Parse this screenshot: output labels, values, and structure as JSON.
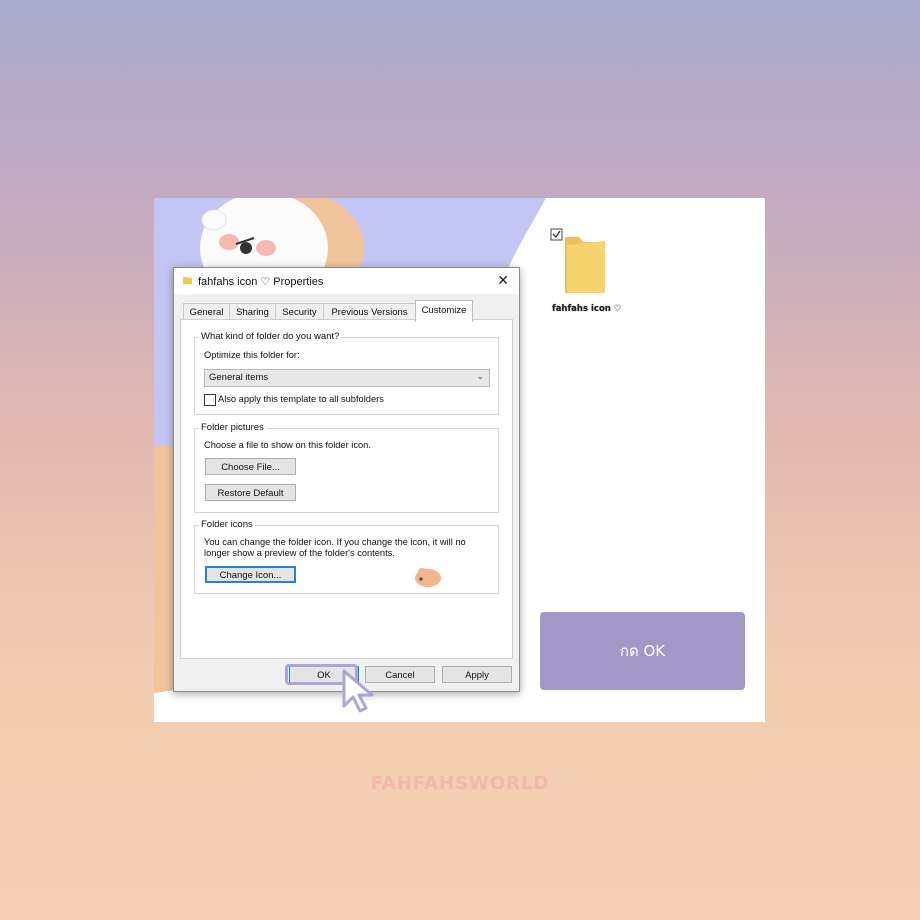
{
  "dialog": {
    "title": "fahfahs icon ♡ Properties",
    "close_glyph": "✕",
    "tabs": [
      {
        "label": "General"
      },
      {
        "label": "Sharing"
      },
      {
        "label": "Security"
      },
      {
        "label": "Previous Versions"
      },
      {
        "label": "Customize",
        "active": true
      }
    ],
    "folder_type": {
      "legend": "What kind of folder do you want?",
      "optimize_label": "Optimize this folder for:",
      "selected": "General items",
      "apply_subfolders_label": "Also apply this template to all subfolders",
      "apply_subfolders_checked": false
    },
    "folder_pictures": {
      "legend": "Folder pictures",
      "description": "Choose a file to show on this folder icon.",
      "choose_file_label": "Choose File...",
      "restore_default_label": "Restore Default"
    },
    "folder_icons": {
      "legend": "Folder icons",
      "description_line1": "You can change the folder icon. If you change the icon, it will no",
      "description_line2": "longer show a preview of the folder's contents.",
      "change_icon_label": "Change Icon..."
    },
    "footer": {
      "ok_label": "OK",
      "cancel_label": "Cancel",
      "apply_label": "Apply"
    }
  },
  "desktop": {
    "folder_label": "fahfahs icon ♡",
    "folder_selected": true
  },
  "instruction_button": {
    "label": "กด OK"
  },
  "brand": {
    "label": "FAHFAHSWORLD"
  },
  "colors": {
    "accent_purple": "#a397c7",
    "blob_lavender": "#c3c6f2",
    "blob_peach": "#f0c49b",
    "focus_blue": "#2a7fd4",
    "brand_pink": "#f2b7ae",
    "folder_yellow": "#f6d36c"
  },
  "icons": [
    "folder-icon",
    "close-icon",
    "chevron-down-icon",
    "cursor-icon",
    "checkbox-icon",
    "bear-sticker-icon"
  ]
}
